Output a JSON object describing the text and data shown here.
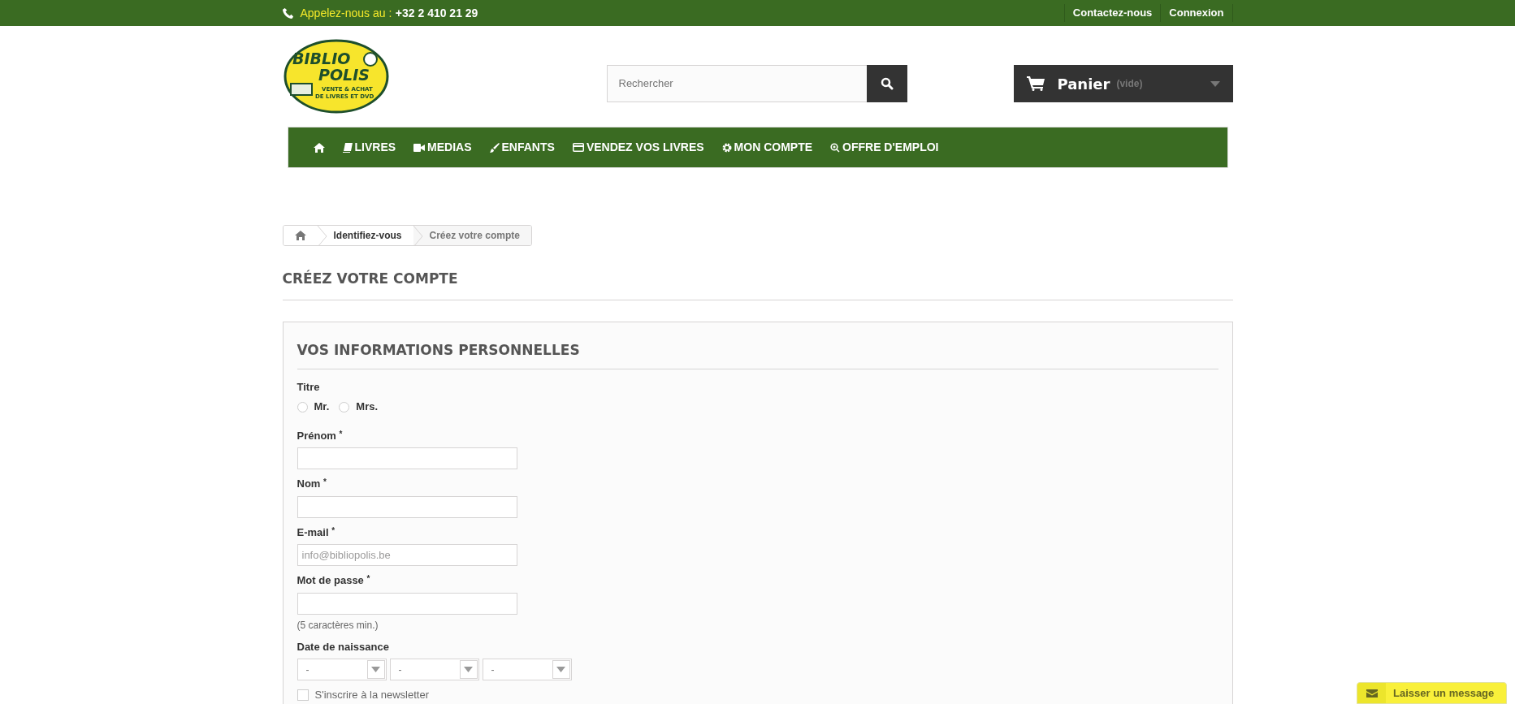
{
  "top_bar": {
    "call_label": "Appelez-nous au :",
    "phone": "+32 2 410 21 29",
    "links": [
      "Contactez-nous",
      "Connexion"
    ]
  },
  "logo": {
    "line_1": "BIBLIO",
    "line_2": "POLIS",
    "tagline_1": "VENTE & ACHAT",
    "tagline_2": "DE LIVRES ET DVD"
  },
  "search": {
    "placeholder": "Rechercher"
  },
  "cart": {
    "label": "Panier",
    "status": "(vide)"
  },
  "menu": [
    "LIVRES",
    "MEDIAS",
    "ENFANTS",
    "VENDEZ VOS LIVRES",
    "MON COMPTE",
    "OFFRE D'EMPLOI"
  ],
  "breadcrumb": [
    {
      "label": "Identifiez-vous",
      "current": false
    },
    {
      "label": "Créez votre compte",
      "current": true
    }
  ],
  "page_title": "CRÉEZ VOTRE COMPTE",
  "form": {
    "section_title": "VOS INFORMATIONS PERSONNELLES",
    "title_label": "Titre",
    "title_options": [
      {
        "label": "Mr.",
        "selected": false
      },
      {
        "label": "Mrs.",
        "selected": false
      }
    ],
    "fields": [
      {
        "label": "Prénom",
        "required": true
      },
      {
        "label": "Nom",
        "required": true
      },
      {
        "label": "E-mail",
        "required": true,
        "value": "info@bibliopolis.be"
      },
      {
        "label": "Mot de passe",
        "required": true,
        "hint": "(5 caractères min.)"
      }
    ],
    "required_mark": "*",
    "birthdate_label": "Date de naissance",
    "birthdate_selects": [
      "-",
      "-",
      "-"
    ],
    "newsletter": {
      "label": "S'inscrire à la newsletter",
      "checked": false
    }
  },
  "chat_button": "Laisser un message"
}
